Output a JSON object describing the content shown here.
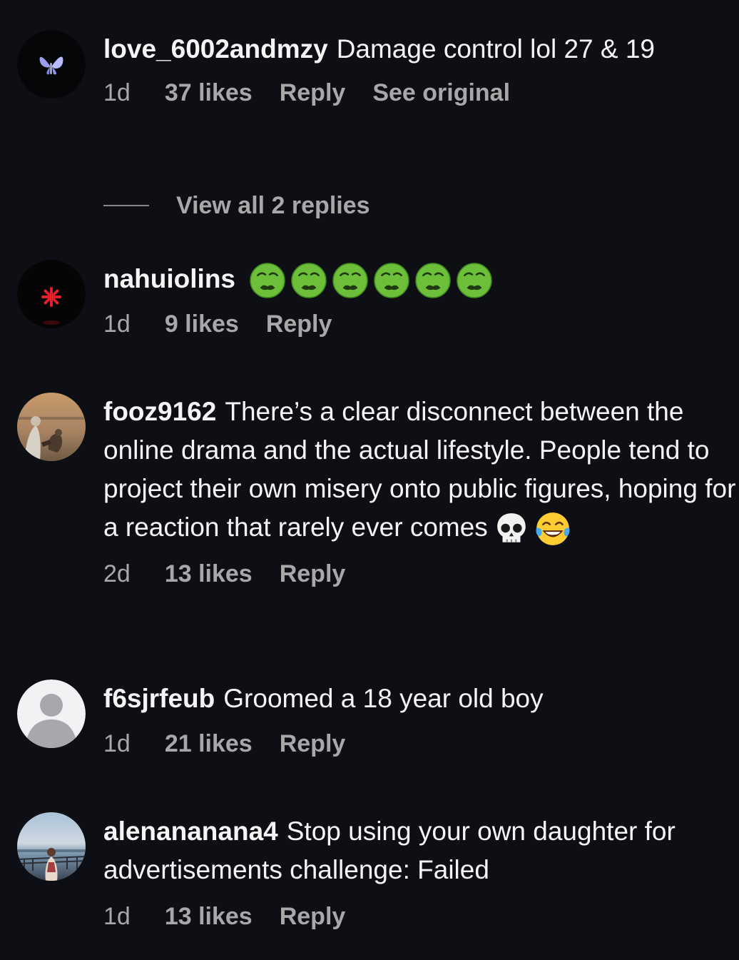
{
  "comments": [
    {
      "username": "love_6002andmzy",
      "text": "Damage control lol 27 & 19",
      "time": "1d",
      "likes": "37 likes",
      "reply_label": "Reply",
      "see_original_label": "See original",
      "view_replies_label": "View all 2 replies"
    },
    {
      "username": "nahuiolins",
      "text": "",
      "emoji": [
        "nauseated-face",
        "nauseated-face",
        "nauseated-face",
        "nauseated-face",
        "nauseated-face",
        "nauseated-face"
      ],
      "time": "1d",
      "likes": "9 likes",
      "reply_label": "Reply"
    },
    {
      "username": "fooz9162",
      "text": "There’s a clear disconnect between the online drama and the actual lifestyle. People tend to project their own misery onto public figures, hoping for a reaction that rarely ever comes",
      "emoji": [
        "skull",
        "tears-of-joy"
      ],
      "time": "2d",
      "likes": "13 likes",
      "reply_label": "Reply"
    },
    {
      "username": "f6sjrfeub",
      "text": "Groomed a 18 year old boy",
      "time": "1d",
      "likes": "21 likes",
      "reply_label": "Reply"
    },
    {
      "username": "alenananana4",
      "text": "Stop using your own daughter for advertisements challenge: Failed",
      "time": "1d",
      "likes": "13 likes",
      "reply_label": "Reply"
    }
  ],
  "colors": {
    "background": "#0d0f14",
    "primary_text": "#f5f5f5",
    "secondary_text": "#a8a8a8"
  }
}
